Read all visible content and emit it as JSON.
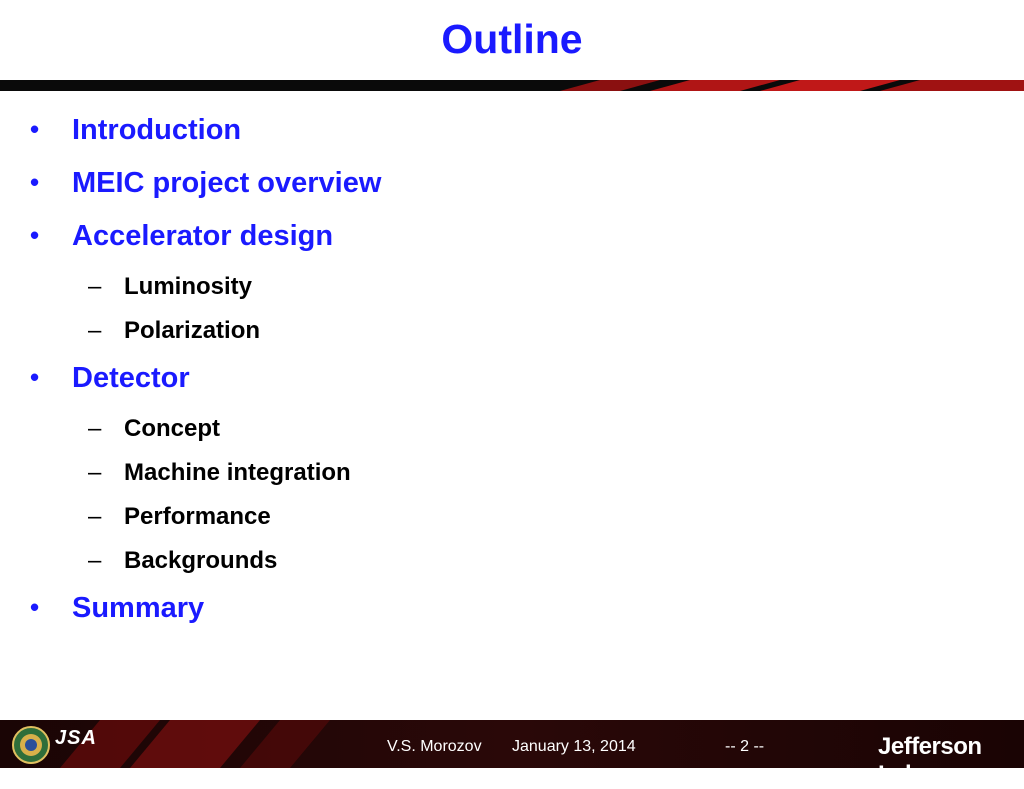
{
  "slide": {
    "title": "Outline"
  },
  "outline": {
    "items": [
      {
        "level": 1,
        "marker": "•",
        "label": "Introduction"
      },
      {
        "level": 1,
        "marker": "•",
        "label": "MEIC project overview"
      },
      {
        "level": 1,
        "marker": "•",
        "label": "Accelerator design"
      },
      {
        "level": 2,
        "marker": "–",
        "label": "Luminosity"
      },
      {
        "level": 2,
        "marker": "–",
        "label": "Polarization"
      },
      {
        "level": 1,
        "marker": "•",
        "label": "Detector"
      },
      {
        "level": 2,
        "marker": "–",
        "label": "Concept"
      },
      {
        "level": 2,
        "marker": "–",
        "label": "Machine integration"
      },
      {
        "level": 2,
        "marker": "–",
        "label": "Performance"
      },
      {
        "level": 2,
        "marker": "–",
        "label": "Backgrounds"
      },
      {
        "level": 1,
        "marker": "•",
        "label": "Summary"
      }
    ]
  },
  "footer": {
    "author": "V.S. Morozov",
    "date": "January 13, 2014",
    "page": "-- 2 --",
    "logo_left_text": "JSA",
    "logo_right_text": "Jefferson Lab"
  },
  "colors": {
    "title": "#1a1aff",
    "bullet_text": "#1a1aff",
    "sub_text": "#000000",
    "footer_bg": "#2a0a0a",
    "accent_red": "#b01010"
  }
}
